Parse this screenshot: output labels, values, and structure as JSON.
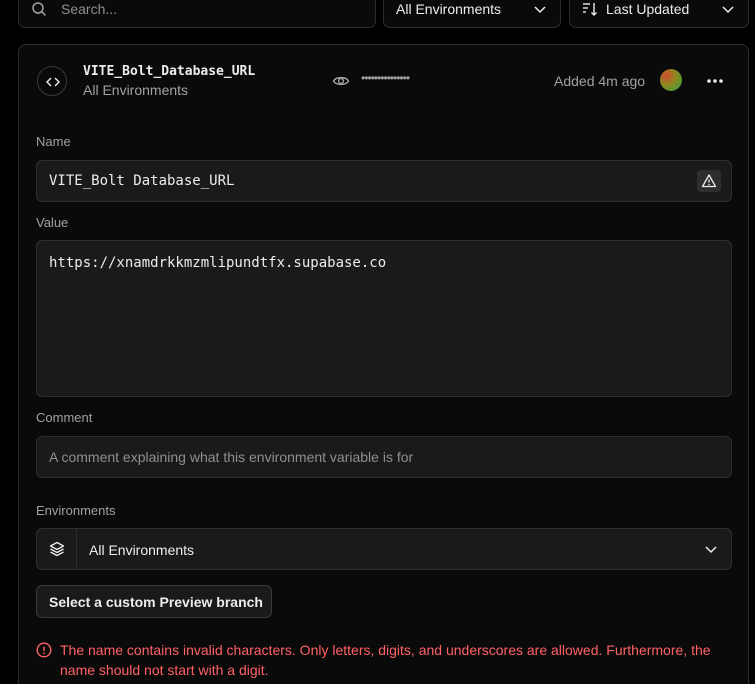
{
  "filters": {
    "search_placeholder": "Search...",
    "environment_filter": "All Environments",
    "sort": "Last Updated"
  },
  "variable": {
    "name": "VITE_Bolt_Database_URL",
    "environment": "All Environments",
    "masked_value": "•••••••••••••••",
    "added": "Added 4m ago"
  },
  "form": {
    "name_label": "Name",
    "name_value": "VITE_Bolt Database_URL",
    "value_label": "Value",
    "value_value": "https://xnamdrkkmzmlipundtfx.supabase.co",
    "comment_label": "Comment",
    "comment_placeholder": "A comment explaining what this environment variable is for",
    "environments_label": "Environments",
    "environments_value": "All Environments",
    "preview_button": "Select a custom Preview branch",
    "error_message": "The name contains invalid characters. Only letters, digits, and underscores are allowed. Furthermore, the name should not start with a digit."
  },
  "icons": {
    "search": "search-icon",
    "chevron": "chevron-down-icon",
    "sort": "sort-icon",
    "code": "code-icon",
    "eye": "eye-icon",
    "more": "more-horizontal-icon",
    "warning": "warning-triangle-icon",
    "layers": "layers-icon",
    "error": "error-circle-icon"
  },
  "colors": {
    "background": "#000000",
    "card": "#0a0a0a",
    "input": "#1a1a1a",
    "border": "#2e2e2e",
    "error": "#ff6166"
  }
}
